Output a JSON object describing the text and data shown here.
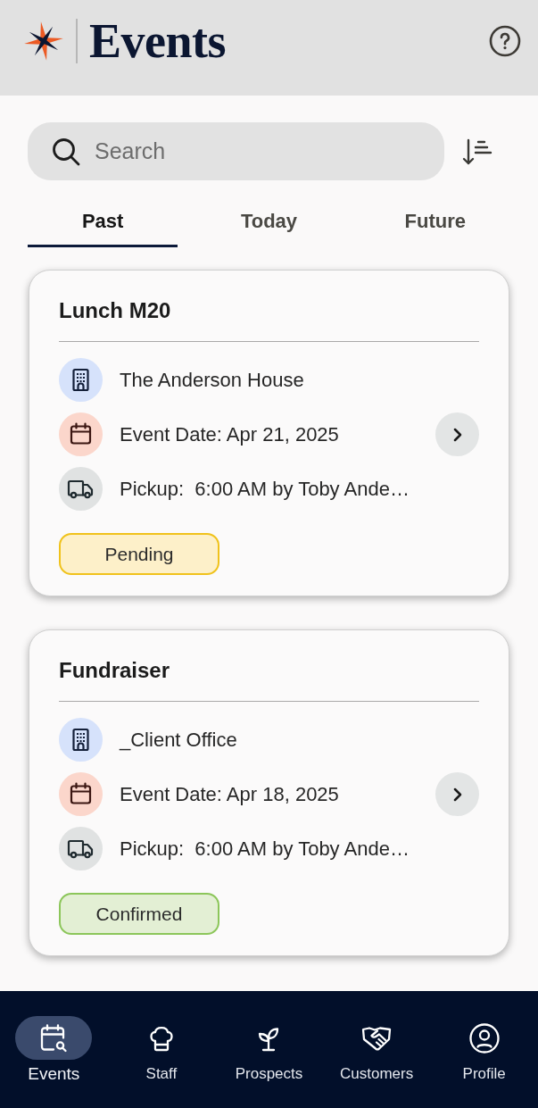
{
  "header": {
    "title": "Events"
  },
  "search": {
    "placeholder": "Search"
  },
  "tabs": [
    {
      "label": "Past",
      "selected": true
    },
    {
      "label": "Today",
      "selected": false
    },
    {
      "label": "Future",
      "selected": false
    }
  ],
  "events": [
    {
      "title": "Lunch M20",
      "venue": "The Anderson House",
      "date": "Event Date: Apr 21, 2025",
      "pickup": "Pickup:  6:00 AM by Toby Ande…",
      "status": {
        "label": "Pending",
        "kind": "pending"
      }
    },
    {
      "title": "Fundraiser",
      "venue": "_Client Office",
      "date": "Event Date: Apr 18, 2025",
      "pickup": "Pickup:  6:00 AM by Toby Ande…",
      "status": {
        "label": "Confirmed",
        "kind": "confirmed"
      }
    }
  ],
  "nav": [
    {
      "label": "Events",
      "kind": "events",
      "selected": true
    },
    {
      "label": "Staff",
      "kind": "staff",
      "selected": false
    },
    {
      "label": "Prospects",
      "kind": "prospects",
      "selected": false
    },
    {
      "label": "Customers",
      "kind": "customers",
      "selected": false
    },
    {
      "label": "Profile",
      "kind": "profile",
      "selected": false
    }
  ]
}
